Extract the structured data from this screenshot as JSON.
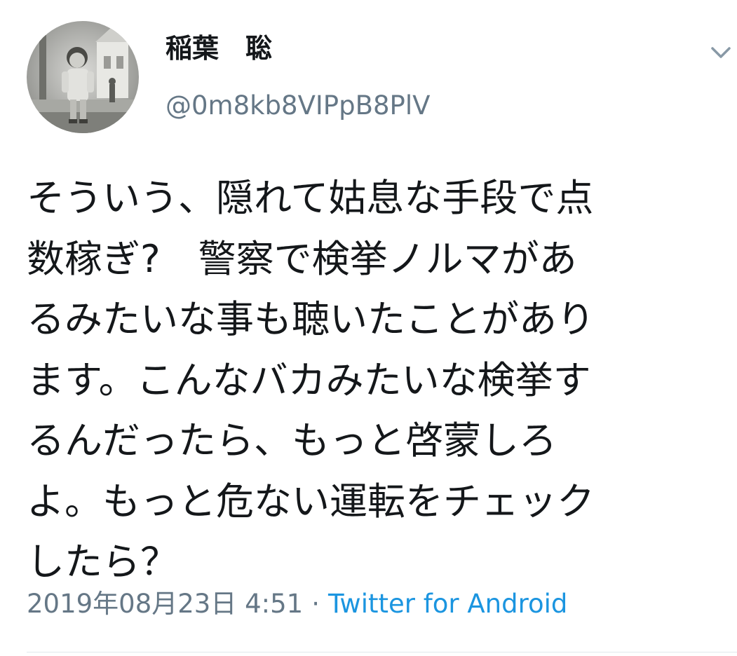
{
  "tweet": {
    "author": {
      "display_name": "稲葉　聡",
      "handle": "@0m8kb8VIPpB8PlV"
    },
    "text_lines": [
      "そういう、隠れて姑息な手段で点",
      "数稼ぎ?　警察で検挙ノルマがあ",
      "るみたいな事も聴いたことがあり",
      "ます。こんなバカみたいな検挙す",
      "るんだったら、もっと啓蒙しろ",
      "よ。もっと危ない運転をチェック",
      "したら？"
    ],
    "timestamp": "2019年08月23日 4:51",
    "separator": "·",
    "source": "Twitter for Android"
  },
  "icons": {
    "caret": "chevron-down-icon"
  },
  "colors": {
    "text": "#14171a",
    "secondary": "#657786",
    "link": "#1b95e0",
    "divider": "#e1e8ed"
  }
}
